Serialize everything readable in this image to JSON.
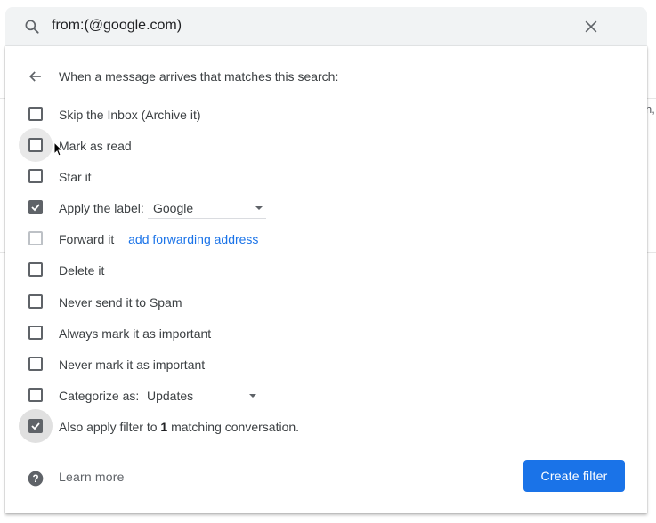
{
  "search": {
    "query": "from:(@google.com)"
  },
  "filter": {
    "header": "When a message arrives that matches this search:",
    "options": [
      {
        "label": "Skip the Inbox (Archive it)",
        "checked": false
      },
      {
        "label": "Mark as read",
        "checked": false
      },
      {
        "label": "Star it",
        "checked": false
      },
      {
        "label": "Apply the label:",
        "checked": true,
        "dropdown": "Google"
      },
      {
        "label": "Forward it",
        "checked": false,
        "disabled": true,
        "link": "add forwarding address"
      },
      {
        "label": "Delete it",
        "checked": false
      },
      {
        "label": "Never send it to Spam",
        "checked": false
      },
      {
        "label": "Always mark it as important",
        "checked": false
      },
      {
        "label": "Never mark it as important",
        "checked": false
      },
      {
        "label": "Categorize as:",
        "checked": false,
        "dropdown": "Updates"
      },
      {
        "label_pre": "Also apply filter to ",
        "label_count": "1",
        "label_post": " matching conversation.",
        "checked": true
      }
    ],
    "learn_more": "Learn more",
    "create_button": "Create filter"
  },
  "background": {
    "clipped_text": "n,"
  },
  "colors": {
    "accent": "#1a73e8",
    "checkbox": "#5f6368",
    "search_bg": "#f1f3f4"
  }
}
